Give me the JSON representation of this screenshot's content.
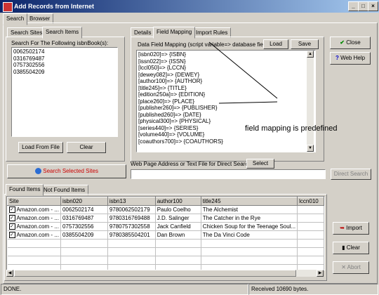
{
  "window": {
    "title": "Add Records from Internet"
  },
  "main_tabs": [
    "Search",
    "Browser"
  ],
  "left_tabs": [
    "Search Sites",
    "Search Items"
  ],
  "search_items": {
    "label": "Search For The Following isbnBook(s):",
    "isbns": [
      "0062502174",
      "0316769487",
      "0757302556",
      "0385504209"
    ],
    "load_from_file": "Load From File",
    "clear": "Clear"
  },
  "right_tabs": [
    "Details",
    "Field Mapping",
    "Import Rules"
  ],
  "field_mapping": {
    "label": "Data Field Mapping (script variable=> database field)",
    "load": "Load",
    "save": "Save",
    "lines": [
      "[isbn020]=> {ISBN}",
      "[issn022]=> {ISSN}",
      "[lccl050]=> {LCCN}",
      "[dewey082]=> {DEWEY}",
      "[author100]=> {AUTHOR}",
      "[title245]=> {TITLE}",
      "[edition250a]=> {EDITION}",
      "[place260]=> {PLACE}",
      "[publisher260]=> {PUBLISHER}",
      "[published260]=> {DATE}",
      "[physical300]=> {PHYSICAL}",
      "[series440]=> {SERIES}",
      "[volume440]=> {VOLUME}",
      "[coauthors700]=> {COAUTHORS}"
    ]
  },
  "annotation": "field mapping is predefined",
  "side_buttons": {
    "close": "Close",
    "web_help": "Web Help"
  },
  "search_selected": "Search Selected Sites",
  "direct": {
    "label": "Web Page Address or Text File for Direct Search:",
    "select": "Select",
    "input_value": "",
    "direct_search": "Direct Search"
  },
  "result_tabs": [
    "Found Items",
    "Not Found Items"
  ],
  "results": {
    "columns": [
      "Site",
      "isbn020",
      "isbn13",
      "author100",
      "title245",
      "lccn010"
    ],
    "rows": [
      [
        "Amazon.com - ...",
        "0062502174",
        "9780062502179",
        "Paulo Coelho",
        "The Alchemist",
        ""
      ],
      [
        "Amazon.com - ...",
        "0316769487",
        "9780316769488",
        "J.D. Salinger",
        "The Catcher in the Rye",
        ""
      ],
      [
        "Amazon.com - ...",
        "0757302556",
        "9780757302558",
        "Jack Canfield",
        "Chicken Soup for the Teenage Soul...",
        ""
      ],
      [
        "Amazon.com - ...",
        "0385504209",
        "9780385504201",
        "Dan Brown",
        "The Da Vinci Code",
        ""
      ]
    ]
  },
  "action_buttons": {
    "import": "Import",
    "clear": "Clear",
    "abort": "Abort"
  },
  "status": {
    "left": "DONE.",
    "right": "Received 10690 bytes."
  }
}
